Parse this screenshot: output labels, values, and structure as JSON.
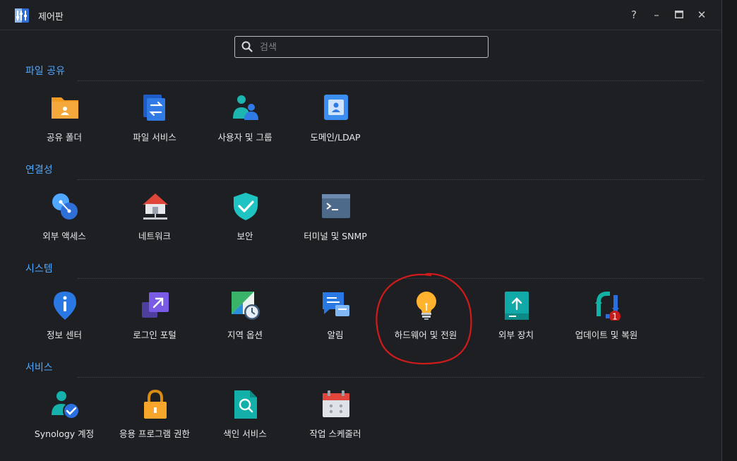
{
  "window": {
    "title": "제어판",
    "controls": [
      "?",
      "–",
      "□",
      "✕"
    ]
  },
  "search": {
    "placeholder": "검색",
    "value": ""
  },
  "sections": [
    {
      "title": "파일 공유",
      "items": [
        "공유 폴더",
        "파일 서비스",
        "사용자 및 그룹",
        "도메인/LDAP"
      ]
    },
    {
      "title": "연결성",
      "items": [
        "외부 액세스",
        "네트워크",
        "보안",
        "터미널 및 SNMP"
      ]
    },
    {
      "title": "시스템",
      "items": [
        "정보 센터",
        "로그인 포털",
        "지역 옵션",
        "알림",
        "하드웨어 및 전원",
        "외부 장치",
        "업데이트 및 복원"
      ]
    },
    {
      "title": "서비스",
      "items": [
        "Synology 계정",
        "응용 프로그램 권한",
        "색인 서비스",
        "작업 스케줄러"
      ]
    }
  ],
  "badges": {
    "update_count": "1"
  },
  "colors": {
    "accent": "#4fa7ff",
    "annotation": "#d51d1d",
    "background": "#1e1f22"
  }
}
